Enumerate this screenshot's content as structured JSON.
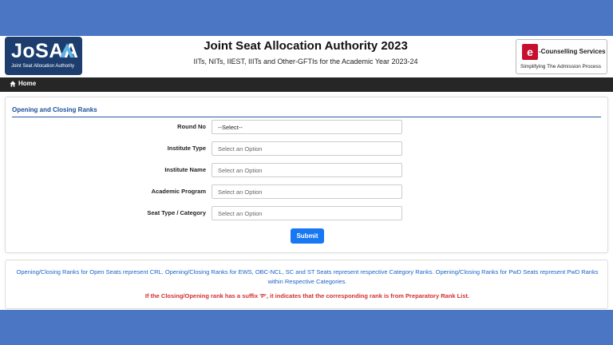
{
  "header": {
    "logo_text": "JoSAA",
    "logo_subtext": "Joint Seat Allocation Authority",
    "title": "Joint Seat Allocation Authority 2023",
    "subtitle": "IITs, NITs, IIEST, IIITs and Other-GFTIs for the Academic Year 2023-24",
    "partner_mark": "e",
    "partner_title": "-Counselling Services",
    "partner_tagline": "Simplifying The Admission Process"
  },
  "nav": {
    "home_label": "Home"
  },
  "form": {
    "section_title": "Opening and Closing Ranks",
    "fields": [
      {
        "label": "Round No",
        "value": "--Select--"
      },
      {
        "label": "Institute Type",
        "value": "Select an Option"
      },
      {
        "label": "Institute Name",
        "value": "Select an Option"
      },
      {
        "label": "Academic Program",
        "value": "Select an Option"
      },
      {
        "label": "Seat Type / Category",
        "value": "Select an Option"
      }
    ],
    "submit_label": "Submit"
  },
  "notes": {
    "info": "Opening/Closing Ranks for Open Seats represent CRL. Opening/Closing Ranks for EWS, OBC-NCL, SC and ST Seats represent respective Category Ranks. Opening/Closing Ranks for PwD Seats represent PwD Ranks within Respective Categories.",
    "warning": "If the Closing/Opening rank has a suffix 'P', it indicates that the corresponding rank is from Preparatory Rank List."
  },
  "colors": {
    "background": "#4a76c4",
    "logo": "#1d3d6e",
    "nav": "#262626",
    "accent": "#1877f2",
    "section_title": "#1a4f9a",
    "info_text": "#1a62c9",
    "warning_text": "#d32f2f"
  },
  "icons": {
    "home": "home-icon",
    "logo_arrow": "arrow-up-icon"
  }
}
